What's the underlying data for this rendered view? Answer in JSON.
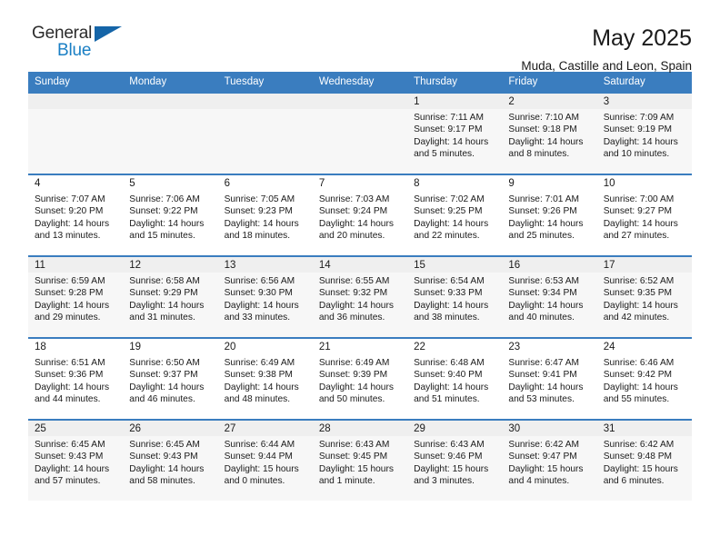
{
  "brand": {
    "name_top": "General",
    "name_bottom": "Blue",
    "flag_icon": "blue-triangle-flag"
  },
  "header": {
    "title": "May 2025",
    "subtitle": "Muda, Castille and Leon, Spain"
  },
  "theme": {
    "header_blue": "#3a7dbf",
    "brand_blue": "#1a7fc4",
    "shaded_cell": "#f7f7f7",
    "daynum_bar": "#efefef"
  },
  "columns": [
    "Sunday",
    "Monday",
    "Tuesday",
    "Wednesday",
    "Thursday",
    "Friday",
    "Saturday"
  ],
  "labels": {
    "sunrise": "Sunrise:",
    "sunset": "Sunset:",
    "daylight": "Daylight:"
  },
  "weeks": [
    [
      {
        "day": "",
        "empty": true
      },
      {
        "day": "",
        "empty": true
      },
      {
        "day": "",
        "empty": true
      },
      {
        "day": "",
        "empty": true
      },
      {
        "day": "1",
        "sunrise": "Sunrise: 7:11 AM",
        "sunset": "Sunset: 9:17 PM",
        "daylight1": "Daylight: 14 hours",
        "daylight2": "and 5 minutes."
      },
      {
        "day": "2",
        "sunrise": "Sunrise: 7:10 AM",
        "sunset": "Sunset: 9:18 PM",
        "daylight1": "Daylight: 14 hours",
        "daylight2": "and 8 minutes."
      },
      {
        "day": "3",
        "sunrise": "Sunrise: 7:09 AM",
        "sunset": "Sunset: 9:19 PM",
        "daylight1": "Daylight: 14 hours",
        "daylight2": "and 10 minutes."
      }
    ],
    [
      {
        "day": "4",
        "sunrise": "Sunrise: 7:07 AM",
        "sunset": "Sunset: 9:20 PM",
        "daylight1": "Daylight: 14 hours",
        "daylight2": "and 13 minutes."
      },
      {
        "day": "5",
        "sunrise": "Sunrise: 7:06 AM",
        "sunset": "Sunset: 9:22 PM",
        "daylight1": "Daylight: 14 hours",
        "daylight2": "and 15 minutes."
      },
      {
        "day": "6",
        "sunrise": "Sunrise: 7:05 AM",
        "sunset": "Sunset: 9:23 PM",
        "daylight1": "Daylight: 14 hours",
        "daylight2": "and 18 minutes."
      },
      {
        "day": "7",
        "sunrise": "Sunrise: 7:03 AM",
        "sunset": "Sunset: 9:24 PM",
        "daylight1": "Daylight: 14 hours",
        "daylight2": "and 20 minutes."
      },
      {
        "day": "8",
        "sunrise": "Sunrise: 7:02 AM",
        "sunset": "Sunset: 9:25 PM",
        "daylight1": "Daylight: 14 hours",
        "daylight2": "and 22 minutes."
      },
      {
        "day": "9",
        "sunrise": "Sunrise: 7:01 AM",
        "sunset": "Sunset: 9:26 PM",
        "daylight1": "Daylight: 14 hours",
        "daylight2": "and 25 minutes."
      },
      {
        "day": "10",
        "sunrise": "Sunrise: 7:00 AM",
        "sunset": "Sunset: 9:27 PM",
        "daylight1": "Daylight: 14 hours",
        "daylight2": "and 27 minutes."
      }
    ],
    [
      {
        "day": "11",
        "sunrise": "Sunrise: 6:59 AM",
        "sunset": "Sunset: 9:28 PM",
        "daylight1": "Daylight: 14 hours",
        "daylight2": "and 29 minutes."
      },
      {
        "day": "12",
        "sunrise": "Sunrise: 6:58 AM",
        "sunset": "Sunset: 9:29 PM",
        "daylight1": "Daylight: 14 hours",
        "daylight2": "and 31 minutes."
      },
      {
        "day": "13",
        "sunrise": "Sunrise: 6:56 AM",
        "sunset": "Sunset: 9:30 PM",
        "daylight1": "Daylight: 14 hours",
        "daylight2": "and 33 minutes."
      },
      {
        "day": "14",
        "sunrise": "Sunrise: 6:55 AM",
        "sunset": "Sunset: 9:32 PM",
        "daylight1": "Daylight: 14 hours",
        "daylight2": "and 36 minutes."
      },
      {
        "day": "15",
        "sunrise": "Sunrise: 6:54 AM",
        "sunset": "Sunset: 9:33 PM",
        "daylight1": "Daylight: 14 hours",
        "daylight2": "and 38 minutes."
      },
      {
        "day": "16",
        "sunrise": "Sunrise: 6:53 AM",
        "sunset": "Sunset: 9:34 PM",
        "daylight1": "Daylight: 14 hours",
        "daylight2": "and 40 minutes."
      },
      {
        "day": "17",
        "sunrise": "Sunrise: 6:52 AM",
        "sunset": "Sunset: 9:35 PM",
        "daylight1": "Daylight: 14 hours",
        "daylight2": "and 42 minutes."
      }
    ],
    [
      {
        "day": "18",
        "sunrise": "Sunrise: 6:51 AM",
        "sunset": "Sunset: 9:36 PM",
        "daylight1": "Daylight: 14 hours",
        "daylight2": "and 44 minutes."
      },
      {
        "day": "19",
        "sunrise": "Sunrise: 6:50 AM",
        "sunset": "Sunset: 9:37 PM",
        "daylight1": "Daylight: 14 hours",
        "daylight2": "and 46 minutes."
      },
      {
        "day": "20",
        "sunrise": "Sunrise: 6:49 AM",
        "sunset": "Sunset: 9:38 PM",
        "daylight1": "Daylight: 14 hours",
        "daylight2": "and 48 minutes."
      },
      {
        "day": "21",
        "sunrise": "Sunrise: 6:49 AM",
        "sunset": "Sunset: 9:39 PM",
        "daylight1": "Daylight: 14 hours",
        "daylight2": "and 50 minutes."
      },
      {
        "day": "22",
        "sunrise": "Sunrise: 6:48 AM",
        "sunset": "Sunset: 9:40 PM",
        "daylight1": "Daylight: 14 hours",
        "daylight2": "and 51 minutes."
      },
      {
        "day": "23",
        "sunrise": "Sunrise: 6:47 AM",
        "sunset": "Sunset: 9:41 PM",
        "daylight1": "Daylight: 14 hours",
        "daylight2": "and 53 minutes."
      },
      {
        "day": "24",
        "sunrise": "Sunrise: 6:46 AM",
        "sunset": "Sunset: 9:42 PM",
        "daylight1": "Daylight: 14 hours",
        "daylight2": "and 55 minutes."
      }
    ],
    [
      {
        "day": "25",
        "sunrise": "Sunrise: 6:45 AM",
        "sunset": "Sunset: 9:43 PM",
        "daylight1": "Daylight: 14 hours",
        "daylight2": "and 57 minutes."
      },
      {
        "day": "26",
        "sunrise": "Sunrise: 6:45 AM",
        "sunset": "Sunset: 9:43 PM",
        "daylight1": "Daylight: 14 hours",
        "daylight2": "and 58 minutes."
      },
      {
        "day": "27",
        "sunrise": "Sunrise: 6:44 AM",
        "sunset": "Sunset: 9:44 PM",
        "daylight1": "Daylight: 15 hours",
        "daylight2": "and 0 minutes."
      },
      {
        "day": "28",
        "sunrise": "Sunrise: 6:43 AM",
        "sunset": "Sunset: 9:45 PM",
        "daylight1": "Daylight: 15 hours",
        "daylight2": "and 1 minute."
      },
      {
        "day": "29",
        "sunrise": "Sunrise: 6:43 AM",
        "sunset": "Sunset: 9:46 PM",
        "daylight1": "Daylight: 15 hours",
        "daylight2": "and 3 minutes."
      },
      {
        "day": "30",
        "sunrise": "Sunrise: 6:42 AM",
        "sunset": "Sunset: 9:47 PM",
        "daylight1": "Daylight: 15 hours",
        "daylight2": "and 4 minutes."
      },
      {
        "day": "31",
        "sunrise": "Sunrise: 6:42 AM",
        "sunset": "Sunset: 9:48 PM",
        "daylight1": "Daylight: 15 hours",
        "daylight2": "and 6 minutes."
      }
    ]
  ]
}
